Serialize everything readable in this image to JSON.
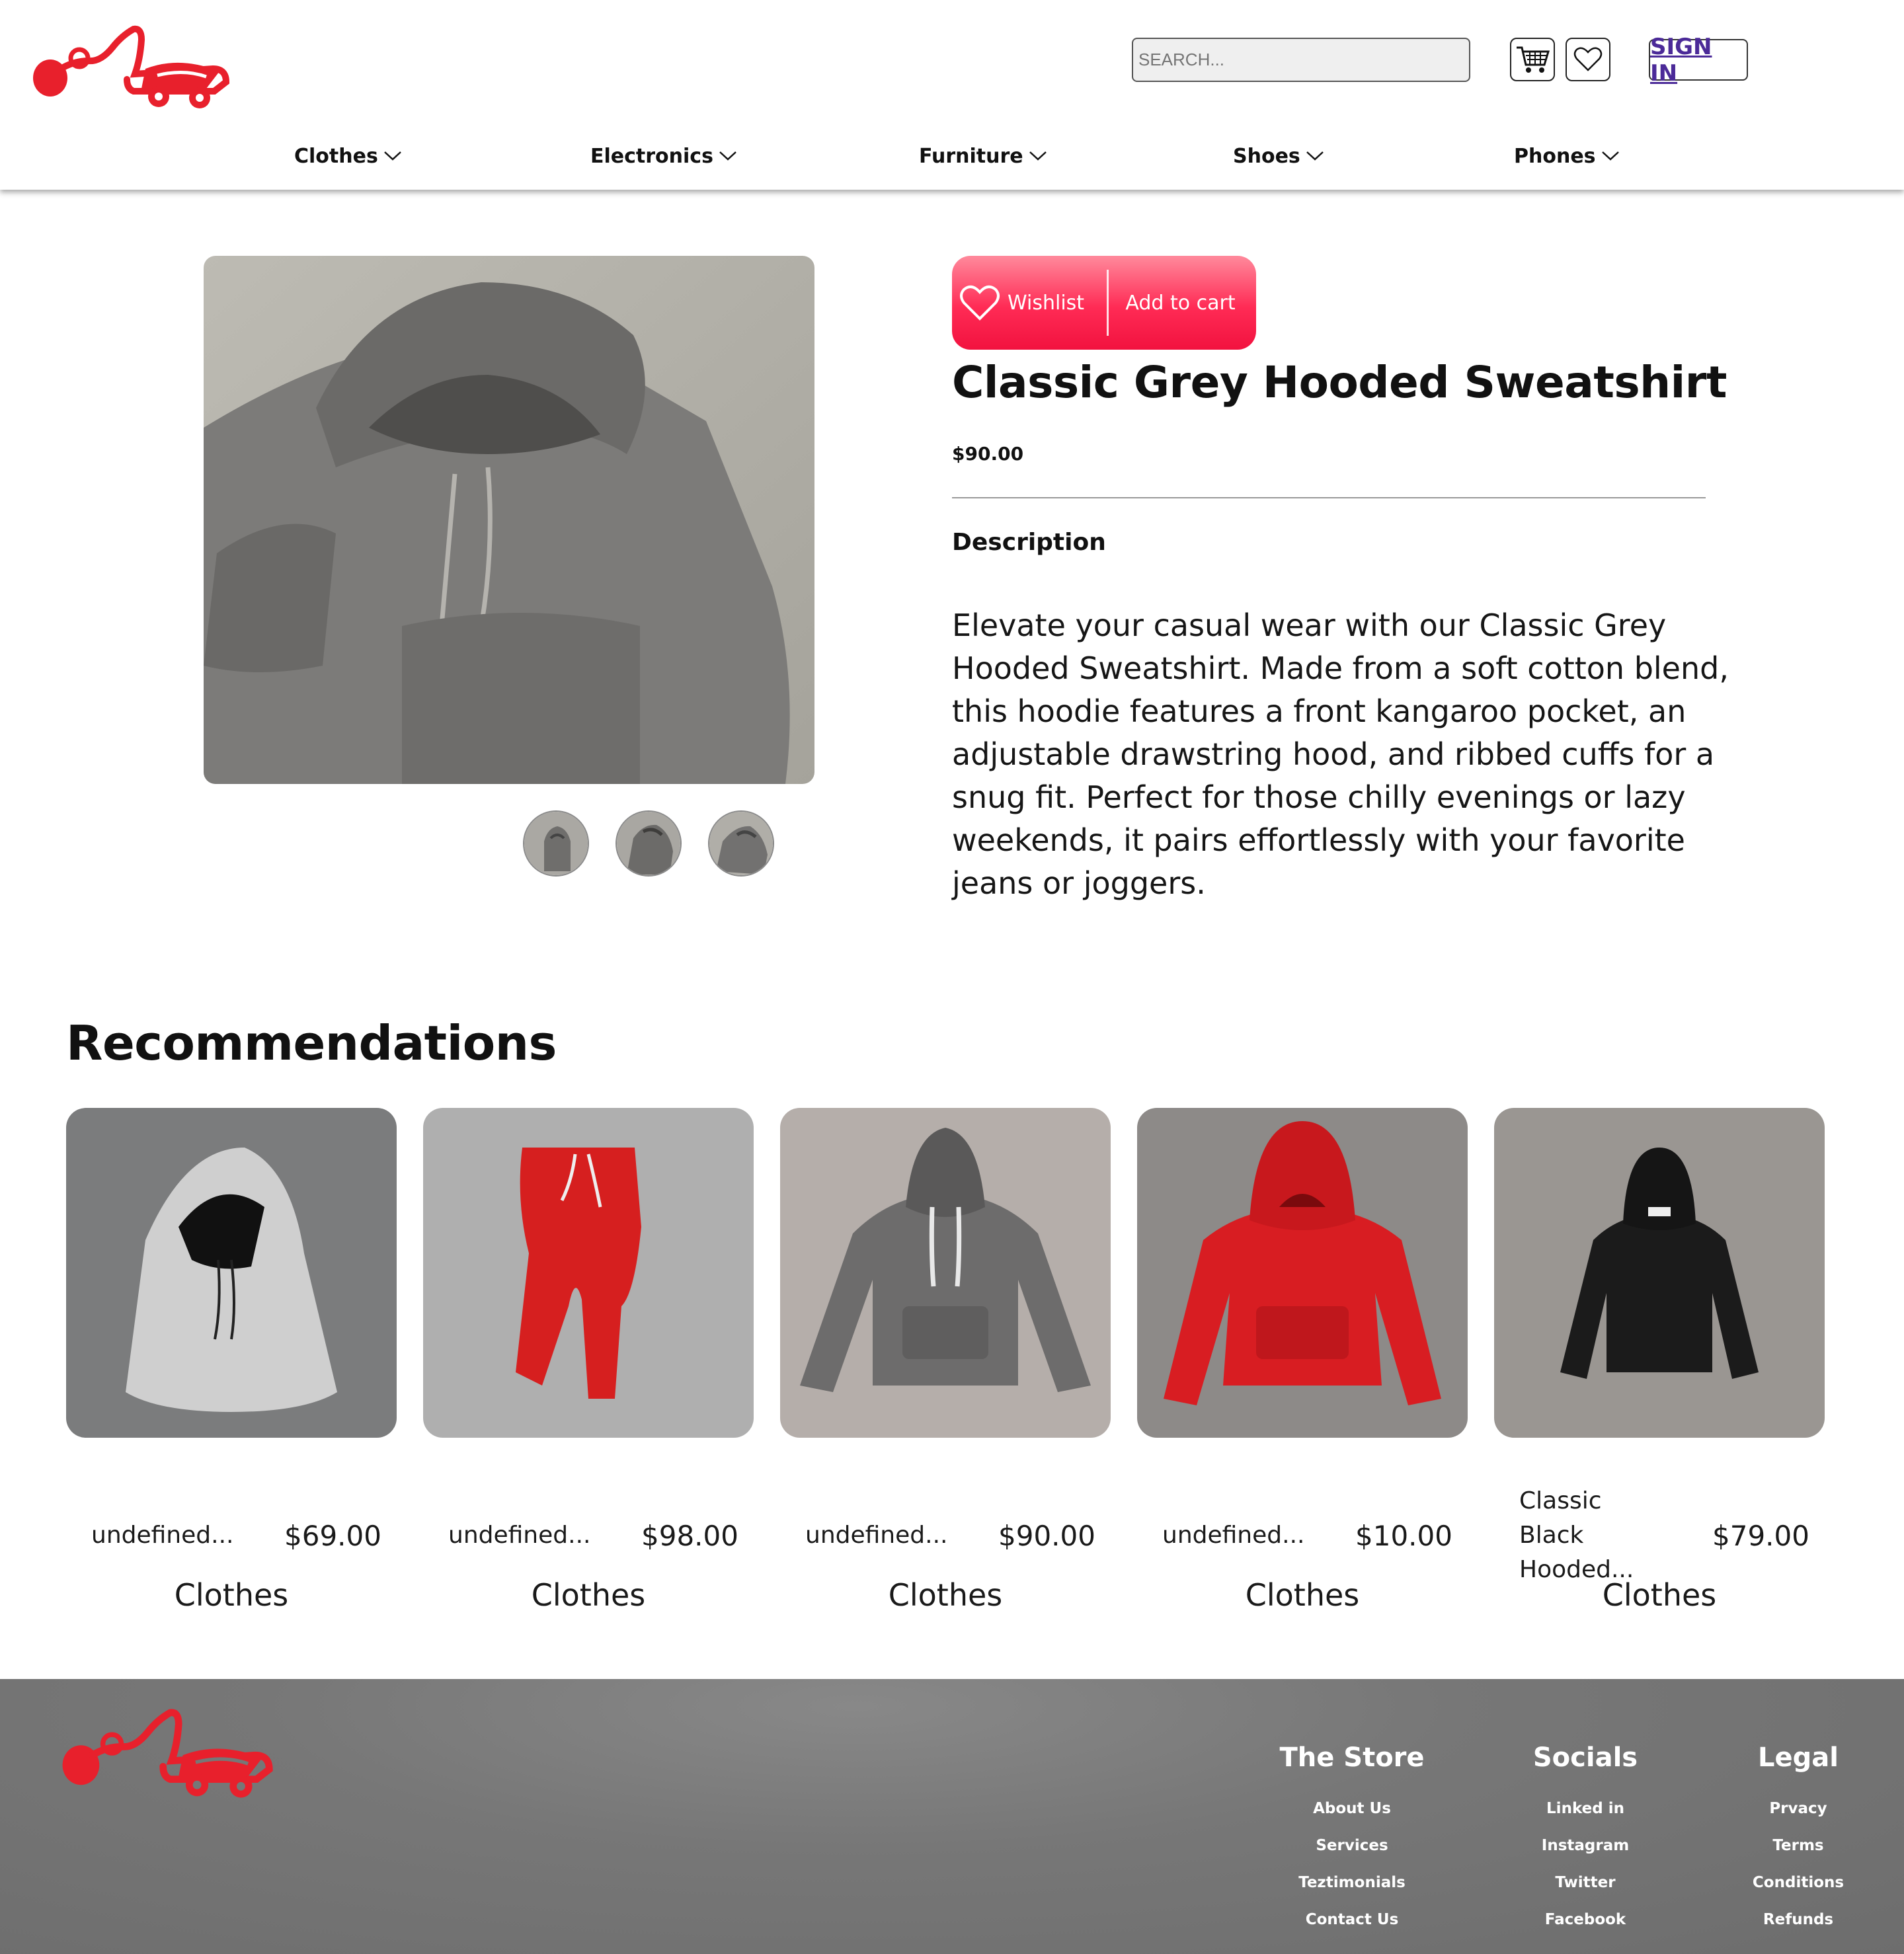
{
  "header": {
    "search_placeholder": "SEARCH...",
    "signin_label": "SIGN IN",
    "nav": [
      "Clothes",
      "Electronics",
      "Furniture",
      "Shoes",
      "Phones"
    ]
  },
  "product": {
    "wishlist_label": "Wishlist",
    "add_to_cart_label": "Add to cart",
    "title": "Classic Grey Hooded Sweatshirt",
    "price": "$90.00",
    "description_label": "Description",
    "description": "Elevate your casual wear with our Classic Grey Hooded Sweatshirt. Made from a soft cotton blend, this hoodie features a front kangaroo pocket, an adjustable drawstring hood, and ribbed cuffs for a snug fit. Perfect for those chilly evenings or lazy weekends, it pairs effortlessly with your favorite jeans or joggers."
  },
  "recommendations": {
    "title": "Recommendations",
    "items": [
      {
        "name": "undefined...",
        "price": "$69.00",
        "category": "Clothes"
      },
      {
        "name": "undefined...",
        "price": "$98.00",
        "category": "Clothes"
      },
      {
        "name": "undefined...",
        "price": "$90.00",
        "category": "Clothes"
      },
      {
        "name": "undefined...",
        "price": "$10.00",
        "category": "Clothes"
      },
      {
        "name": "Classic Black Hooded...",
        "price": "$79.00",
        "category": "Clothes"
      }
    ]
  },
  "footer": {
    "columns": [
      {
        "heading": "The Store",
        "links": [
          "About Us",
          "Services",
          "Teztimonials",
          "Contact Us"
        ]
      },
      {
        "heading": "Socials",
        "links": [
          "Linked in",
          "Instagram",
          "Twitter",
          "Facebook"
        ]
      },
      {
        "heading": "Legal",
        "links": [
          "Prvacy",
          "Terms",
          "Conditions",
          "Refunds"
        ]
      }
    ]
  },
  "colors": {
    "brand_red": "#e8202c",
    "accent_pink": "#ff2b55",
    "signin_purple": "#4b2a98",
    "footer_grey": "#777777"
  }
}
